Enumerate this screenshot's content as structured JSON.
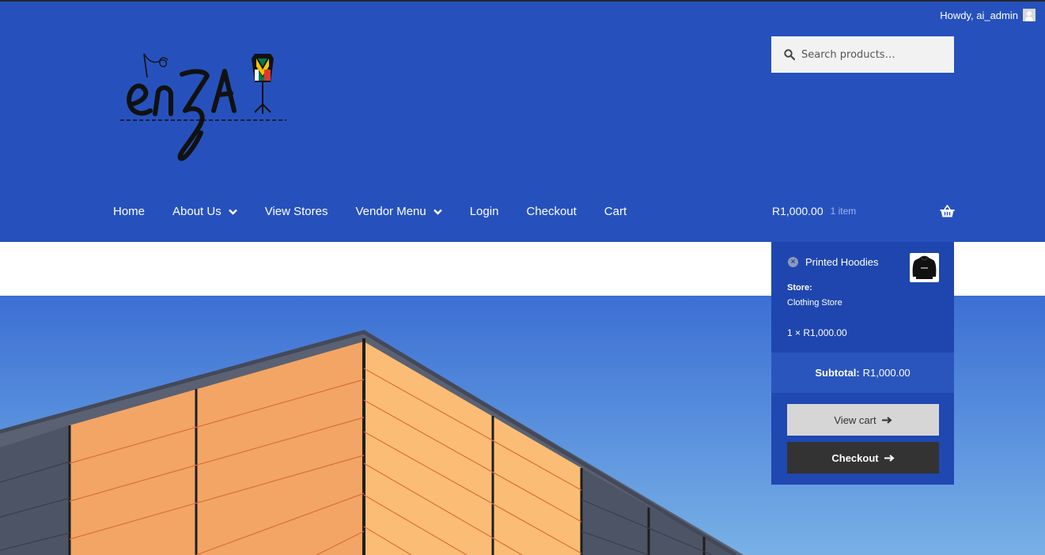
{
  "admin_bar": {
    "greeting": "Howdy, ai_admin"
  },
  "logo": {
    "text": "enZA"
  },
  "search": {
    "placeholder": "Search products…"
  },
  "nav": {
    "items": [
      {
        "label": "Home",
        "has_dropdown": false
      },
      {
        "label": "About Us",
        "has_dropdown": true
      },
      {
        "label": "View Stores",
        "has_dropdown": false
      },
      {
        "label": "Vendor Menu",
        "has_dropdown": true
      },
      {
        "label": "Login",
        "has_dropdown": false
      },
      {
        "label": "Checkout",
        "has_dropdown": false
      },
      {
        "label": "Cart",
        "has_dropdown": false
      }
    ]
  },
  "cart": {
    "amount": "R1,000.00",
    "count": "1 item",
    "icon": "basket-icon"
  },
  "minicart": {
    "item": {
      "remove_icon": "remove-icon",
      "name": "Printed Hoodies",
      "store_label": "Store:",
      "store_name": "Clothing Store",
      "quantity_price": "1 × R1,000.00"
    },
    "subtotal_label": "Subtotal:",
    "subtotal_value": "R1,000.00",
    "view_cart_label": "View cart",
    "checkout_label": "Checkout"
  },
  "colors": {
    "header_bg": "#2651bd",
    "minicart_bg": "#1f48b0",
    "checkout_button": "#333333",
    "view_cart_button": "#d6d6d6",
    "hero_orange": "#f5a66a"
  }
}
